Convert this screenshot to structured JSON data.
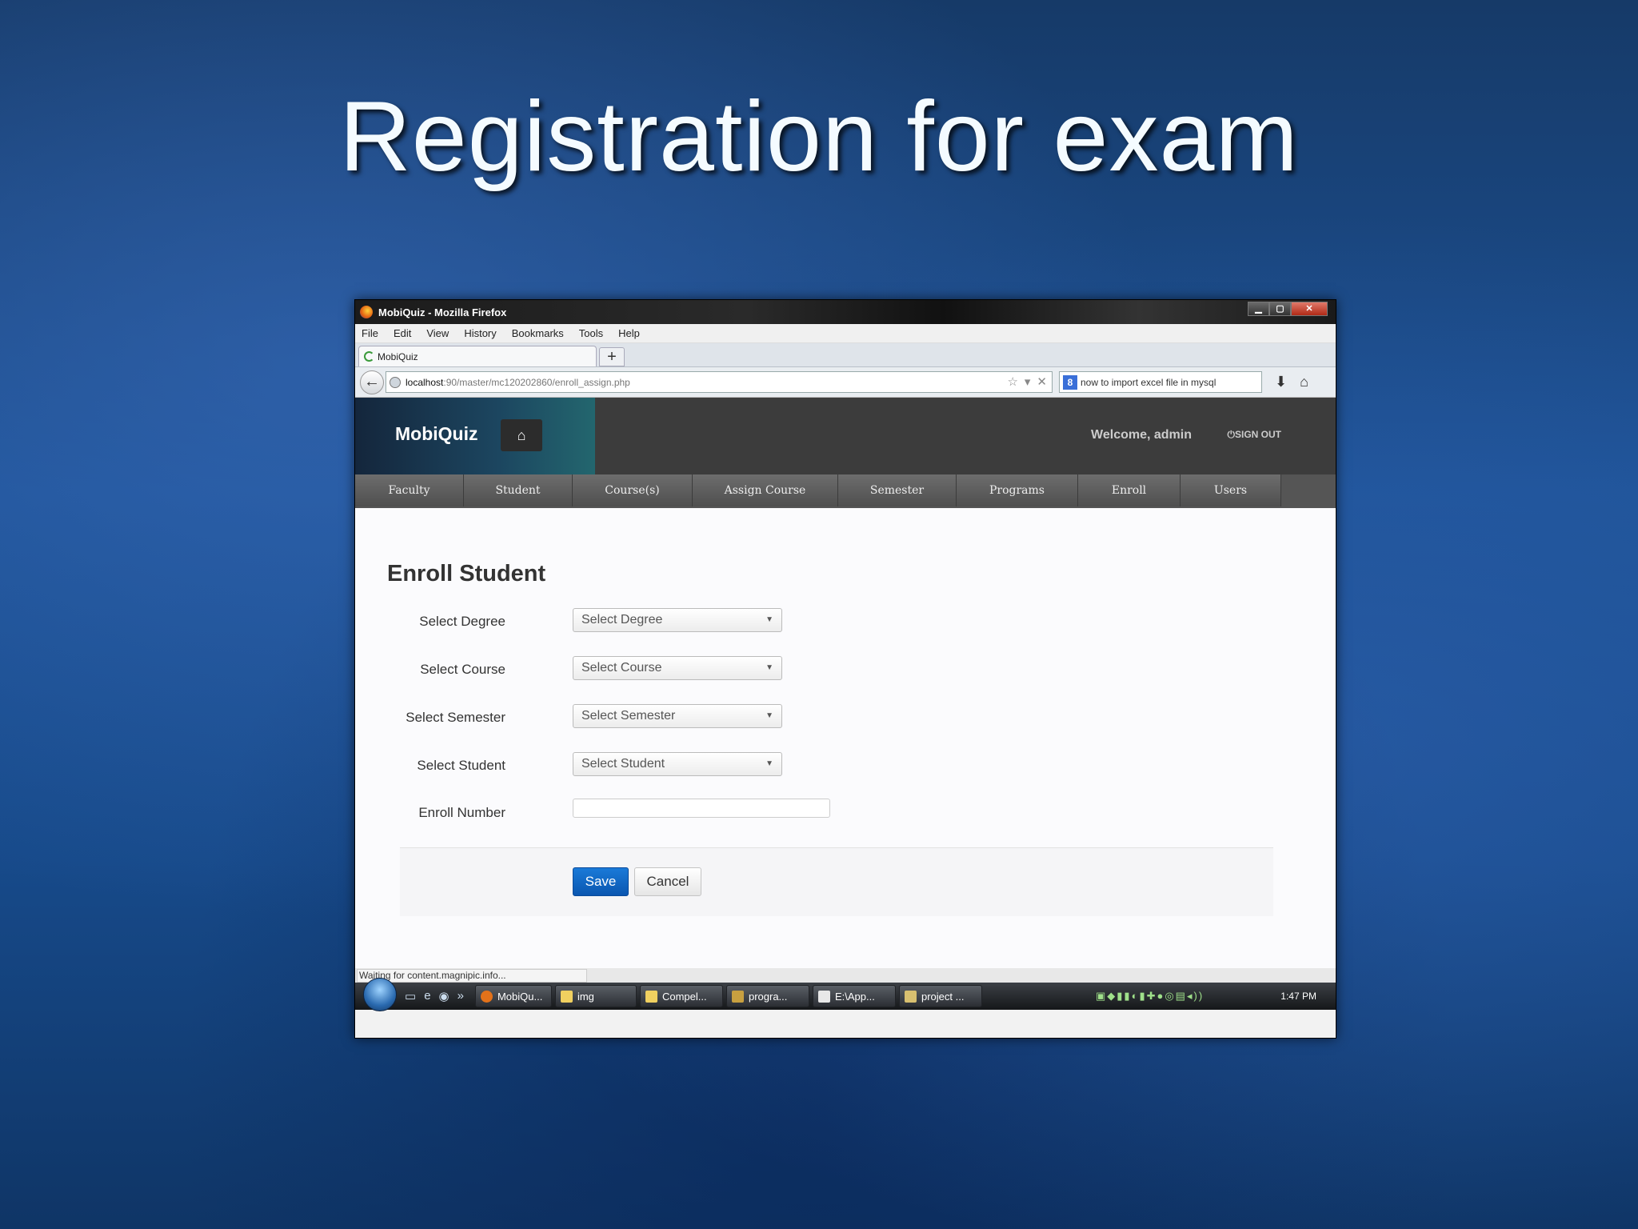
{
  "slide": {
    "title": "Registration for exam"
  },
  "browser": {
    "window_title": "MobiQuiz - Mozilla Firefox",
    "menu": [
      "File",
      "Edit",
      "View",
      "History",
      "Bookmarks",
      "Tools",
      "Help"
    ],
    "tab_title": "MobiQuiz",
    "url_host": "localhost",
    "url_path": ":90/master/mc120202860/enroll_assign.php",
    "search_value": "now to import excel file in mysql",
    "status_text": "Waiting for content.magnipic.info..."
  },
  "app": {
    "brand": "MobiQuiz",
    "welcome": "Welcome, admin",
    "signout": "SIGN OUT",
    "nav": [
      "Faculty",
      "Student",
      "Course(s)",
      "Assign Course",
      "Semester",
      "Programs",
      "Enroll",
      "Users"
    ]
  },
  "form": {
    "heading": "Enroll Student",
    "degree_label": "Select Degree",
    "degree_value": "Select Degree",
    "course_label": "Select Course",
    "course_value": "Select Course",
    "semester_label": "Select Semester",
    "semester_value": "Select Semester",
    "student_label": "Select Student",
    "student_value": "Select Student",
    "enroll_label": "Enroll Number",
    "enroll_value": "",
    "save_label": "Save",
    "cancel_label": "Cancel"
  },
  "taskbar": {
    "items": [
      "MobiQu...",
      "img",
      "Compel...",
      "progra...",
      "E:\\App...",
      "project ..."
    ],
    "clock": "1:47 PM"
  },
  "colors": {
    "accent": "#0a63c4",
    "header": "#3c3c3c"
  }
}
